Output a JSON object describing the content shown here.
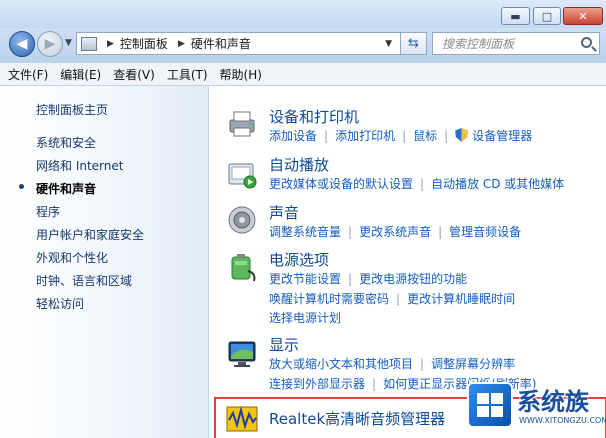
{
  "window": {
    "buttons": {
      "minimize": "▬",
      "maximize": "□",
      "close": "✕"
    }
  },
  "nav": {
    "back_icon": "back-arrow-icon",
    "forward_icon": "forward-arrow-icon",
    "breadcrumb": [
      "控制面板",
      "硬件和声音"
    ],
    "search_placeholder": "搜索控制面板"
  },
  "menu": [
    "文件(F)",
    "编辑(E)",
    "查看(V)",
    "工具(T)",
    "帮助(H)"
  ],
  "sidebar": {
    "items": [
      {
        "label": "控制面板主页",
        "active": false
      },
      {
        "label": "系统和安全",
        "active": false
      },
      {
        "label": "网络和 Internet",
        "active": false
      },
      {
        "label": "硬件和声音",
        "active": true
      },
      {
        "label": "程序",
        "active": false
      },
      {
        "label": "用户帐户和家庭安全",
        "active": false
      },
      {
        "label": "外观和个性化",
        "active": false
      },
      {
        "label": "时钟、语言和区域",
        "active": false
      },
      {
        "label": "轻松访问",
        "active": false
      }
    ]
  },
  "categories": [
    {
      "title": "设备和打印机",
      "icon": "printer-icon",
      "lines": [
        [
          "添加设备",
          "添加打印机",
          "鼠标",
          "设备管理器"
        ]
      ]
    },
    {
      "title": "自动播放",
      "icon": "autoplay-icon",
      "lines": [
        [
          "更改媒体或设备的默认设置",
          "自动播放 CD 或其他媒体"
        ]
      ]
    },
    {
      "title": "声音",
      "icon": "speaker-icon",
      "lines": [
        [
          "调整系统音量",
          "更改系统声音",
          "管理音频设备"
        ]
      ]
    },
    {
      "title": "电源选项",
      "icon": "battery-icon",
      "lines": [
        [
          "更改节能设置",
          "更改电源按钮的功能"
        ],
        [
          "唤醒计算机时需要密码",
          "更改计算机睡眠时间"
        ],
        [
          "选择电源计划"
        ]
      ]
    },
    {
      "title": "显示",
      "icon": "monitor-icon",
      "lines": [
        [
          "放大或缩小文本和其他项目",
          "调整屏幕分辨率"
        ],
        [
          "连接到外部显示器",
          "如何更正显示器闪烁(刷新率)"
        ]
      ]
    }
  ],
  "realtek": {
    "title": "Realtek高清晰音频管理器",
    "icon": "realtek-audio-icon"
  },
  "watermark": {
    "text": "系统族",
    "sub": "WWW.XITONGZU.COM"
  }
}
